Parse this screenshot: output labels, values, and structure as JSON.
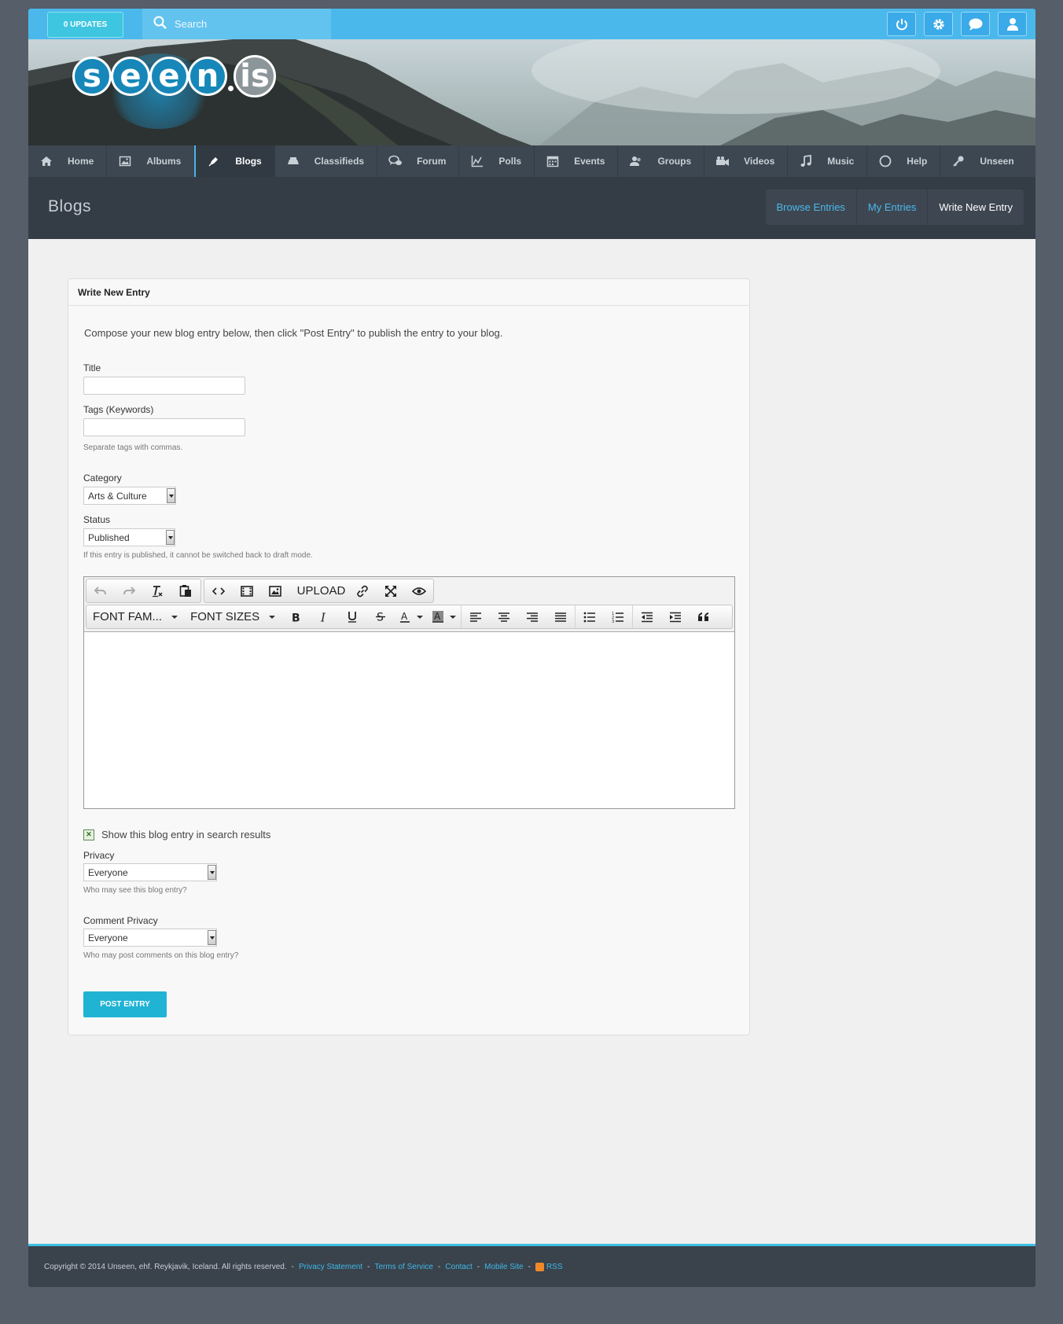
{
  "topbar": {
    "updates_label": "0 UPDATES",
    "search_placeholder": "Search",
    "icons": [
      "power-icon",
      "gear-icon",
      "chat-icon",
      "user-icon"
    ]
  },
  "banner": {
    "logo_letters": [
      "s",
      "e",
      "e",
      "n",
      "i",
      "s"
    ]
  },
  "nav": {
    "items": [
      {
        "label": "Home",
        "icon": "home-icon"
      },
      {
        "label": "Albums",
        "icon": "albums-icon"
      },
      {
        "label": "Blogs",
        "icon": "pen-icon",
        "active": true
      },
      {
        "label": "Classifieds",
        "icon": "classifieds-icon"
      },
      {
        "label": "Forum",
        "icon": "forum-icon"
      },
      {
        "label": "Polls",
        "icon": "polls-icon"
      },
      {
        "label": "Events",
        "icon": "calendar-icon"
      },
      {
        "label": "Groups",
        "icon": "groups-icon"
      },
      {
        "label": "Videos",
        "icon": "video-icon"
      },
      {
        "label": "Music",
        "icon": "music-icon"
      },
      {
        "label": "Help",
        "icon": "help-icon"
      },
      {
        "label": "Unseen",
        "icon": "key-icon"
      }
    ]
  },
  "section": {
    "title": "Blogs",
    "tabs": [
      {
        "label": "Browse Entries"
      },
      {
        "label": "My Entries"
      },
      {
        "label": "Write New Entry",
        "active": true
      }
    ]
  },
  "form": {
    "heading": "Write New Entry",
    "intro": "Compose your new blog entry below, then click \"Post Entry\" to publish the entry to your blog.",
    "title_label": "Title",
    "title_value": "",
    "tags_label": "Tags (Keywords)",
    "tags_value": "",
    "tags_hint": "Separate tags with commas.",
    "category_label": "Category",
    "category_value": "Arts & Culture",
    "status_label": "Status",
    "status_value": "Published",
    "status_hint": "If this entry is published, it cannot be switched back to draft mode.",
    "editor": {
      "upload_label": "UPLOAD",
      "font_family_label": "FONT FAM...",
      "font_sizes_label": "FONT SIZES"
    },
    "search_checkbox_label": "Show this blog entry in search results",
    "privacy_label": "Privacy",
    "privacy_value": "Everyone",
    "privacy_hint": "Who may see this blog entry?",
    "comment_privacy_label": "Comment Privacy",
    "comment_privacy_value": "Everyone",
    "comment_privacy_hint": "Who may post comments on this blog entry?",
    "submit_label": "POST ENTRY"
  },
  "footer": {
    "copyright": "Copyright © 2014 Unseen, ehf. Reykjavik, Iceland. All rights reserved.",
    "links": [
      "Privacy Statement",
      "Terms of Service",
      "Contact",
      "Mobile Site",
      "RSS"
    ]
  },
  "colors": {
    "accent": "#4bb8ec",
    "nav_bg": "#3d4751",
    "button": "#21b3d4"
  }
}
